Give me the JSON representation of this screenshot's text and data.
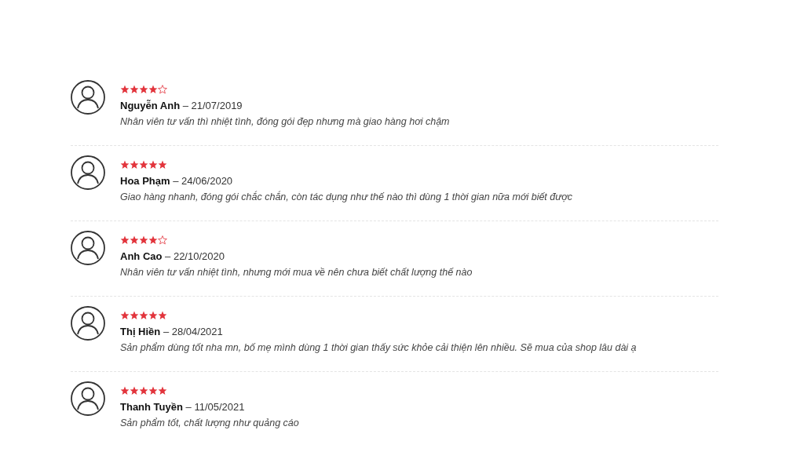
{
  "reviews": [
    {
      "stars": 4,
      "meta": "**Nguyễn Anh** – 21/07/2019",
      "text": "Nhân viên tư vấn thì nhiệt tình, đóng gói đẹp nhưng mà giao hàng hơi chậm"
    },
    {
      "stars": 5,
      "meta": "**Hoa Phạm** – 24/06/2020",
      "text": "Giao hàng nhanh, đóng gói chắc chắn, còn tác dụng như thế nào thì dùng 1 thời gian nữa mới biết được"
    },
    {
      "stars": 4,
      "meta": "**Anh Cao** – 22/10/2020",
      "text": "Nhân viên tư vấn nhiệt tình, nhưng mới mua về nên chưa biết chất lượng thế nào"
    },
    {
      "stars": 5,
      "meta": "**Thị Hiền** – 28/04/2021",
      "text": "Sản phẩm dùng tốt nha mn, bố mẹ mình dùng 1 thời gian thấy sức khỏe cải thiện lên nhiều. Sẽ mua của shop lâu dài ạ"
    },
    {
      "stars": 5,
      "meta": "**Thanh Tuyền** – 11/05/2021",
      "text": "Sản phẩm tốt, chất lượng như quảng cáo"
    }
  ]
}
